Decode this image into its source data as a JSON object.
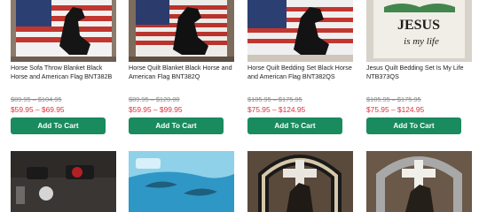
{
  "products": [
    {
      "title": "Horse Sofa Throw Blanket Black Horse and American Flag BNT382B",
      "old_price": "$89.95 – $104.95",
      "price": "$59.95 – $69.95",
      "button": "Add To Cart",
      "image": "horse-flag-blanket-image"
    },
    {
      "title": "Horse Quilt Blanket Black Horse and American Flag BNT382Q",
      "old_price": "$89.95 – $120.00",
      "price": "$59.95 – $99.95",
      "button": "Add To Cart",
      "image": "horse-flag-quilt-image"
    },
    {
      "title": "Horse Quilt Bedding Set Black Horse and American Flag BNT382QS",
      "old_price": "$105.95 – $175.95",
      "price": "$75.95 – $124.95",
      "button": "Add To Cart",
      "image": "horse-flag-bedding-image"
    },
    {
      "title": "Jesus Quilt Bedding Set Is My Life NTB373QS",
      "old_price": "$105.95 – $175.95",
      "price": "$75.95 – $124.95",
      "button": "Add To Cart",
      "image": "jesus-quilt-image",
      "image_text_1": "JESUS",
      "image_text_2": "is my life"
    }
  ],
  "row2_images": [
    "skull-rose-bedding-image",
    "dolphin-bedding-image",
    "cross-horseshoe-horse-image",
    "cross-horseshoe-quilt-image"
  ]
}
